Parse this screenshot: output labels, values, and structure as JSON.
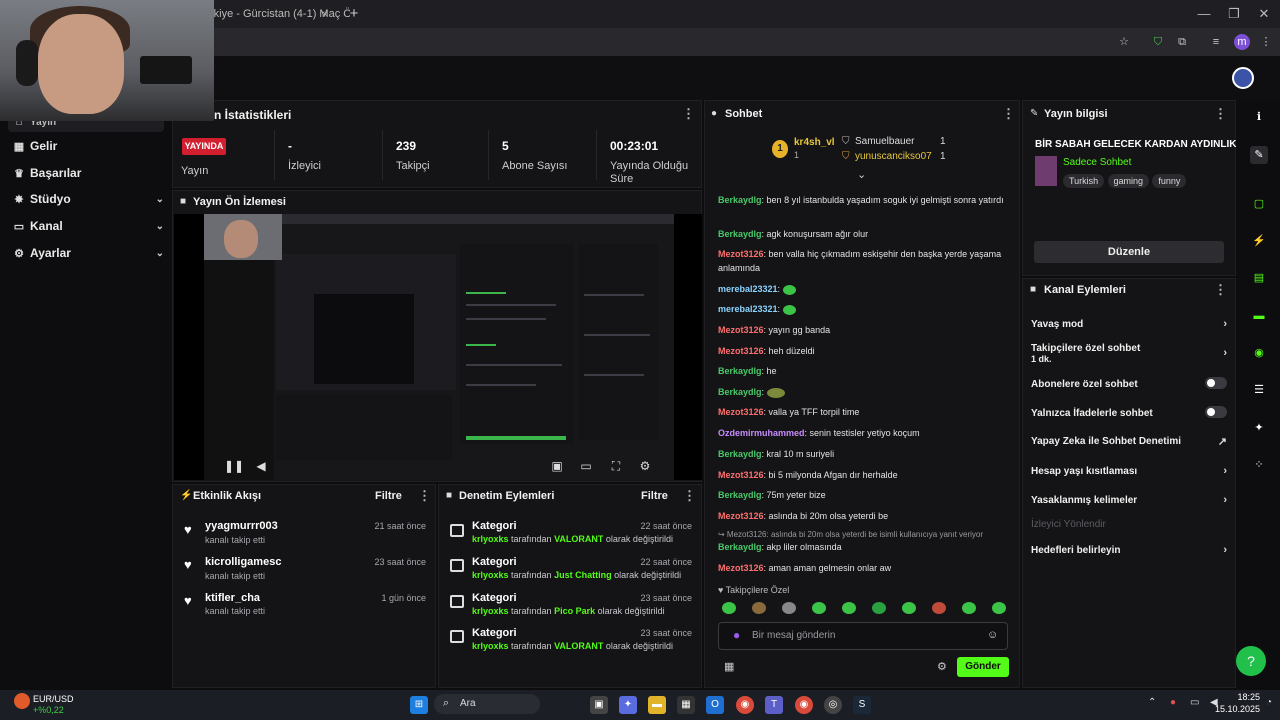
{
  "browser": {
    "tab_title": "rkiye - Gürcistan (4-1) Maç Ö",
    "tab_close": "×",
    "new_tab": "+",
    "minimize": "—",
    "restore": "❐",
    "close": "✕"
  },
  "nav": {
    "items": [
      {
        "label": "Yayın",
        "icon": "home-icon"
      },
      {
        "label": "Gelir",
        "icon": "dollar-icon"
      },
      {
        "label": "Başarılar",
        "icon": "trophy-icon"
      },
      {
        "label": "Stüdyo",
        "icon": "studio-icon",
        "chevron": "⌄"
      },
      {
        "label": "Kanal",
        "icon": "channel-icon",
        "chevron": "⌄"
      },
      {
        "label": "Ayarlar",
        "icon": "gear-icon",
        "chevron": "⌄"
      }
    ]
  },
  "stats": {
    "title": "n İstatistikleri",
    "live_badge": "YAYINDA",
    "items": [
      {
        "value": "",
        "label": "Yayın"
      },
      {
        "value": "-",
        "label": "İzleyici"
      },
      {
        "value": "239",
        "label": "Takipçi"
      },
      {
        "value": "5",
        "label": "Abone Sayısı"
      },
      {
        "value": "00:23:01",
        "label": "Yayında Olduğu",
        "label2": "Süre"
      }
    ]
  },
  "preview": {
    "title": "Yayın Ön İzlemesi"
  },
  "activity": {
    "title": "Etkinlik Akışı",
    "filter": "Filtre",
    "items": [
      {
        "name": "yyagmurrr003",
        "sub": "kanalı takip etti",
        "time": "21 saat önce"
      },
      {
        "name": "kicrolligamesc",
        "sub": "kanalı takip etti",
        "time": "23 saat önce"
      },
      {
        "name": "ktifler_cha",
        "sub": "kanalı takip etti",
        "time": "1 gün önce"
      }
    ]
  },
  "moderation": {
    "title": "Denetim Eylemleri",
    "filter": "Filtre",
    "items": [
      {
        "title": "Kategori",
        "user": "krlyoxks",
        "mid": " tarafından ",
        "cat": "VALORANT",
        "end": " olarak değiştirildi",
        "time": "22 saat önce"
      },
      {
        "title": "Kategori",
        "user": "krlyoxks",
        "mid": " tarafından ",
        "cat": "Just Chatting",
        "end": " olarak değiştirildi",
        "time": "22 saat önce"
      },
      {
        "title": "Kategori",
        "user": "krlyoxks",
        "mid": " tarafından ",
        "cat": "Pico Park",
        "end": " olarak değiştirildi",
        "time": "23 saat önce"
      },
      {
        "title": "Kategori",
        "user": "krlyoxks",
        "mid": " tarafından ",
        "cat": "VALORANT",
        "end": " olarak değiştirildi",
        "time": "23 saat önce"
      }
    ]
  },
  "chat": {
    "title": "Sohbet",
    "leader_1": "kr4sh_vl",
    "leader_1_count": "1",
    "leader_2": "Samuelbauer",
    "leader_2_count": "1",
    "leader_3": "yunuscancikso07",
    "leader_3_count": "1",
    "messages": [
      {
        "user": "Berkaydlg",
        "color": "g",
        "text": "ben 8 yıl istanbulda yaşadım soguk iyi gelmişti sonra yatırdı"
      },
      {
        "user": "Berkaydlg",
        "color": "g",
        "text": "agk konuşursam ağır olur"
      },
      {
        "user": "Mezot3126",
        "color": "r",
        "text": "ben valla hiç çıkmadım eskişehir den başka yerde yaşama anlamında"
      },
      {
        "user": "merebal23321",
        "color": "c",
        "text": "",
        "emote": true
      },
      {
        "user": "merebal23321",
        "color": "c",
        "text": "",
        "emote": true
      },
      {
        "user": "Mezot3126",
        "color": "r",
        "text": "yayın gg banda"
      },
      {
        "user": "Mezot3126",
        "color": "r",
        "text": "heh düzeldi"
      },
      {
        "user": "Berkaydlg",
        "color": "g",
        "text": "he"
      },
      {
        "user": "Berkaydlg",
        "color": "g",
        "text": "",
        "emote2": true
      },
      {
        "user": "Mezot3126",
        "color": "r",
        "text": "valla ya TFF torpil time"
      },
      {
        "user": "Ozdemirmuhammed",
        "color": "p",
        "text": "senin testisler yetiyo koçum"
      },
      {
        "user": "Berkaydlg",
        "color": "g",
        "text": "kral 10 m suriyeli"
      },
      {
        "user": "Mezot3126",
        "color": "r",
        "text": "bi 5 milyonda Afgan dır herhalde"
      },
      {
        "user": "Berkaydlg",
        "color": "g",
        "text": "75m yeter bize"
      },
      {
        "user": "Mezot3126",
        "color": "r",
        "text": "aslında bi 20m olsa yeterdi be"
      }
    ],
    "reply_line": "↪ Mezot3126: aslında bi 20m olsa yeterdi be isimli kullanıcıya yanıt veriyor",
    "tail": [
      {
        "user": "Berkaydlg",
        "color": "g",
        "text": "akp liler olmasında"
      },
      {
        "user": "Mezot3126",
        "color": "r",
        "text": "aman aman gelmesin onlar aw"
      }
    ],
    "followers_only": "♥ Takipçilere Özel",
    "input_placeholder": "Bir mesaj gönderin",
    "send": "Gönder"
  },
  "stream_info": {
    "title": "Yayın bilgisi",
    "stream_title": "BİR SABAH GELECEK KARDAN AYDINLIK",
    "category": "Sadece Sohbet",
    "tags": [
      "Turkish",
      "gaming",
      "funny"
    ],
    "edit": "Düzenle"
  },
  "channel_actions": {
    "title": "Kanal Eylemleri",
    "items": [
      {
        "label": "Yavaş mod",
        "right": "›"
      },
      {
        "label": "Takipçilere özel sohbet",
        "label2": "1 dk.",
        "right": "›"
      },
      {
        "label": "Abonelere özel sohbet",
        "toggle": true
      },
      {
        "label": "Yalnızca İfadelerle sohbet",
        "toggle": true
      },
      {
        "label": "Yapay Zeka ile Sohbet Denetimi",
        "right": "↗"
      },
      {
        "label": "Hesap yaşı kısıtlaması",
        "right": "›"
      },
      {
        "label": "Yasaklanmış kelimeler",
        "right": "›"
      },
      {
        "label": "İzleyici Yönlendir",
        "disabled": true
      },
      {
        "label": "Hedefleri belirleyin",
        "right": "›"
      }
    ]
  },
  "taskbar": {
    "ticker": "EUR/USD",
    "ticker_change": "+%0,22",
    "search": "Ara",
    "time": "18:25",
    "date": "15.10.2025"
  },
  "colors": {
    "accent": "#53fc18",
    "live": "#d11f2f",
    "chat_green": "#49c96a",
    "chat_red": "#ff6f6f",
    "chat_purple": "#c78cff"
  }
}
